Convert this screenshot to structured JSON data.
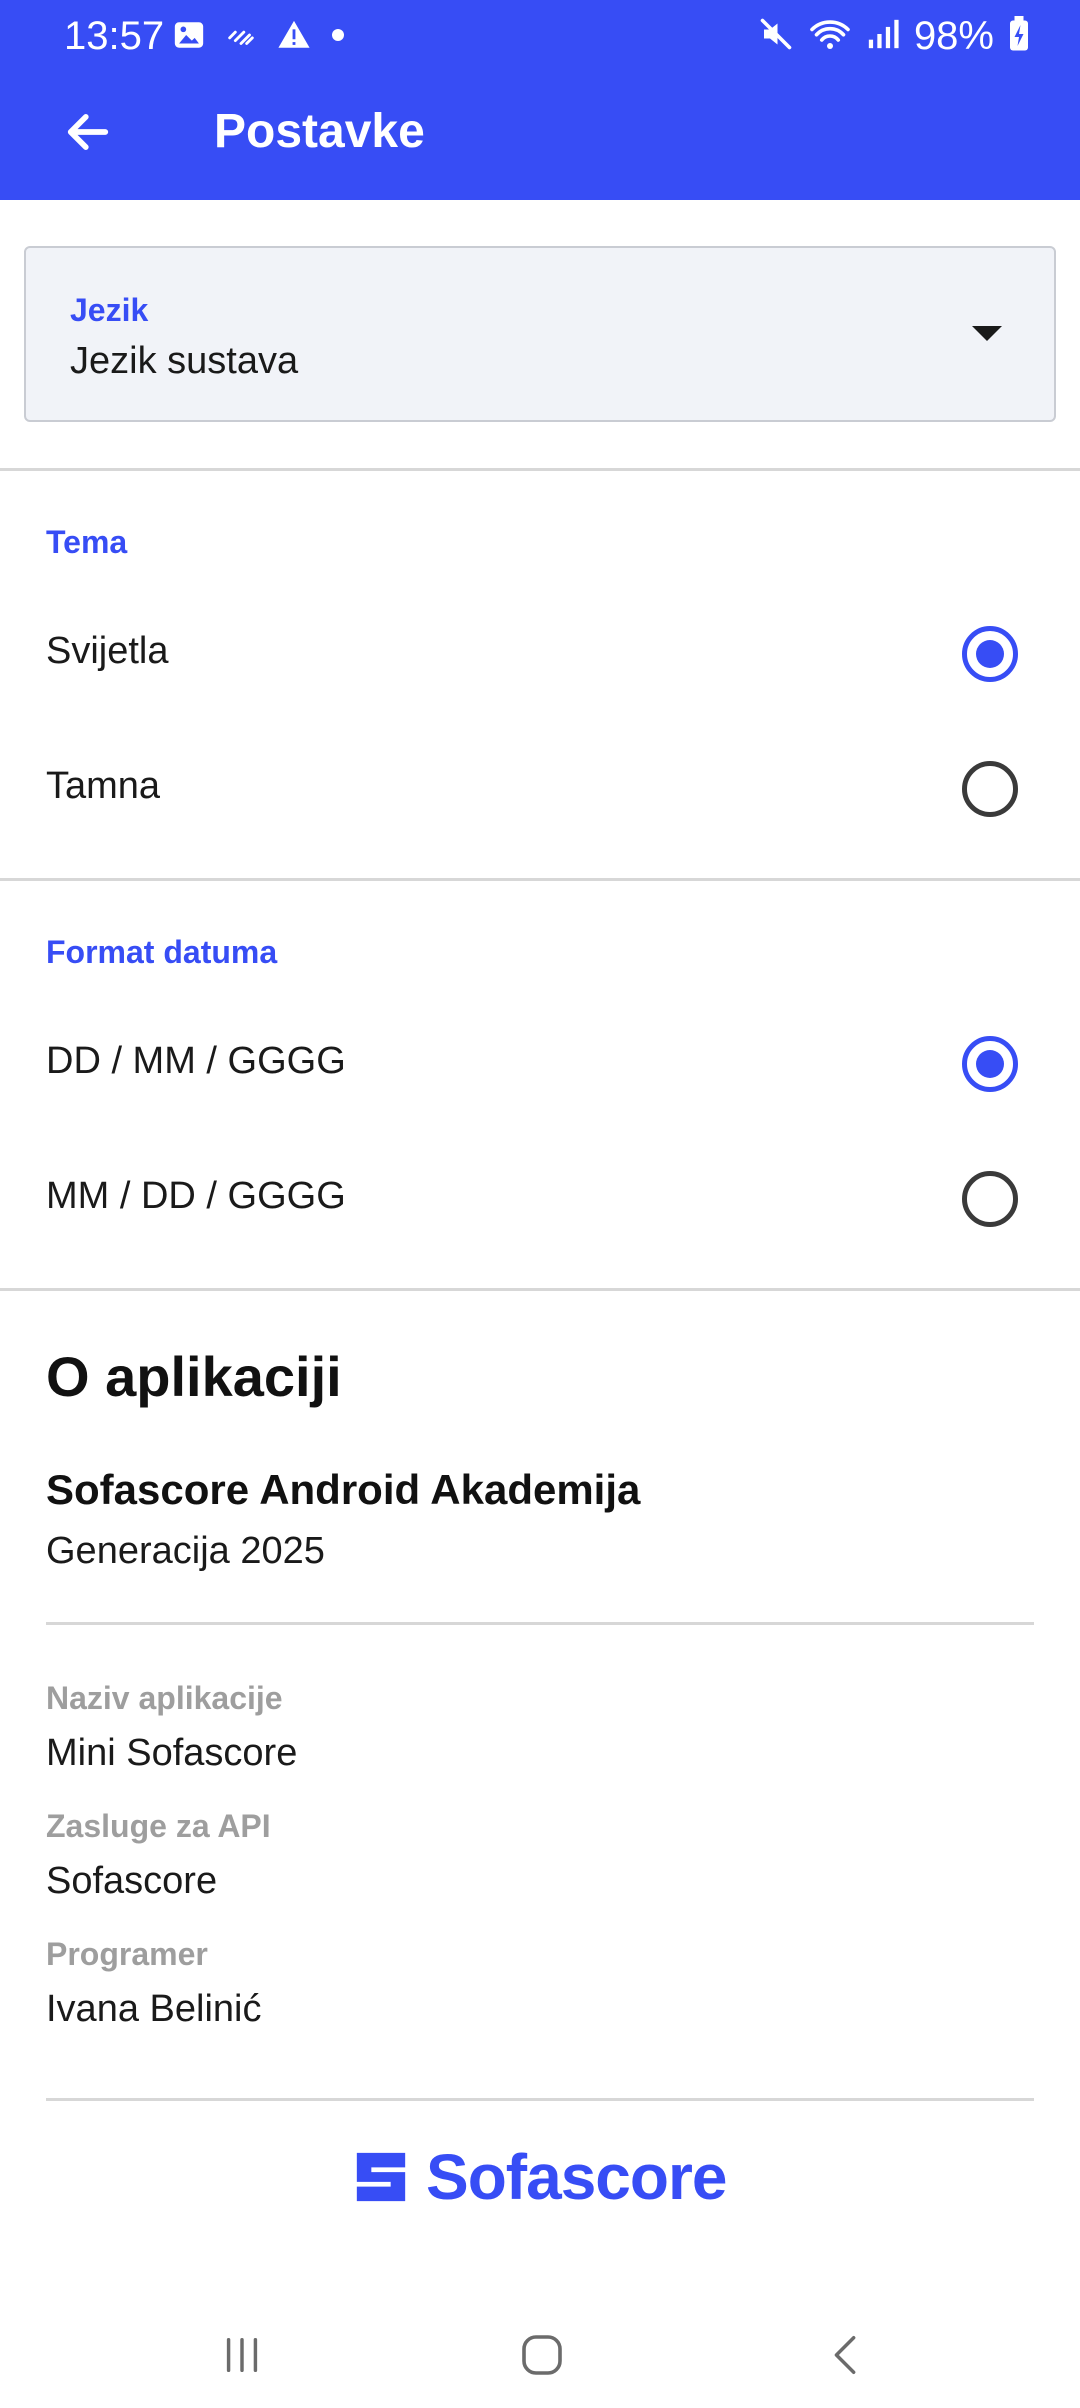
{
  "status_bar": {
    "time": "13:57",
    "battery": "98%",
    "left_icons": [
      "image-icon",
      "sync-icon",
      "warning-icon",
      "dot-icon"
    ],
    "right_icons": [
      "mute-icon",
      "wifi-icon",
      "signal-icon",
      "battery-charging-icon"
    ]
  },
  "app_bar": {
    "title": "Postavke",
    "back_icon": "arrow-back-icon"
  },
  "language": {
    "label": "Jezik",
    "value": "Jezik sustava"
  },
  "theme": {
    "title": "Tema",
    "options": [
      {
        "label": "Svijetla",
        "selected": true
      },
      {
        "label": "Tamna",
        "selected": false
      }
    ]
  },
  "date_format": {
    "title": "Format datuma",
    "options": [
      {
        "label": "DD / MM / GGGG",
        "selected": true
      },
      {
        "label": "MM / DD / GGGG",
        "selected": false
      }
    ]
  },
  "about": {
    "title": "O aplikaciji",
    "academy": "Sofascore Android Akademija",
    "generation": "Generacija 2025",
    "app_name_label": "Naziv aplikacije",
    "app_name_value": "Mini Sofascore",
    "api_label": "Zasluge za API",
    "api_value": "Sofascore",
    "developer_label": "Programer",
    "developer_value": "Ivana Belinić"
  },
  "logo": {
    "text": "Sofascore"
  },
  "colors": {
    "accent": "#374df5",
    "muted_label": "#9e9e9e"
  }
}
